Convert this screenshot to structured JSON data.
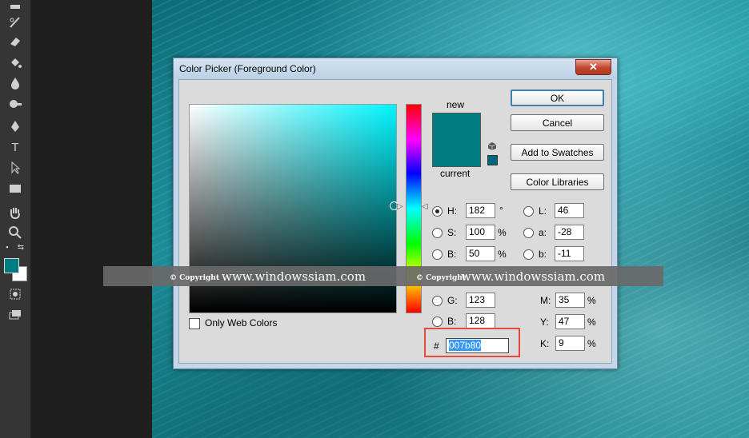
{
  "dialog": {
    "title": "Color Picker (Foreground Color)",
    "close_label": "✕",
    "new_label": "new",
    "current_label": "current",
    "color_new": "#007b80",
    "color_current": "#007b80",
    "websafe_color": "#006680"
  },
  "buttons": {
    "ok": "OK",
    "cancel": "Cancel",
    "add_to_swatches": "Add to Swatches",
    "color_libraries": "Color Libraries"
  },
  "hsb": {
    "h": {
      "label": "H:",
      "value": "182",
      "unit": "°",
      "selected": true
    },
    "s": {
      "label": "S:",
      "value": "100",
      "unit": "%"
    },
    "b": {
      "label": "B:",
      "value": "50",
      "unit": "%"
    }
  },
  "lab": {
    "l": {
      "label": "L:",
      "value": "46"
    },
    "a": {
      "label": "a:",
      "value": "-28"
    },
    "b": {
      "label": "b:",
      "value": "-11"
    }
  },
  "rgb": {
    "g": {
      "label": "G:",
      "value": "123"
    },
    "b": {
      "label": "B:",
      "value": "128"
    }
  },
  "cmyk": {
    "m": {
      "label": "M:",
      "value": "35",
      "unit": "%"
    },
    "y": {
      "label": "Y:",
      "value": "47",
      "unit": "%"
    },
    "k": {
      "label": "K:",
      "value": "9",
      "unit": "%"
    }
  },
  "hex": {
    "hash": "#",
    "value": "007b80"
  },
  "only_web_colors": "Only Web Colors",
  "watermark": {
    "copyright": "© Copyright",
    "site": "www.windowssiam.com"
  },
  "toolbar": {
    "foreground_color": "#007b80",
    "background_color": "#ffffff"
  }
}
